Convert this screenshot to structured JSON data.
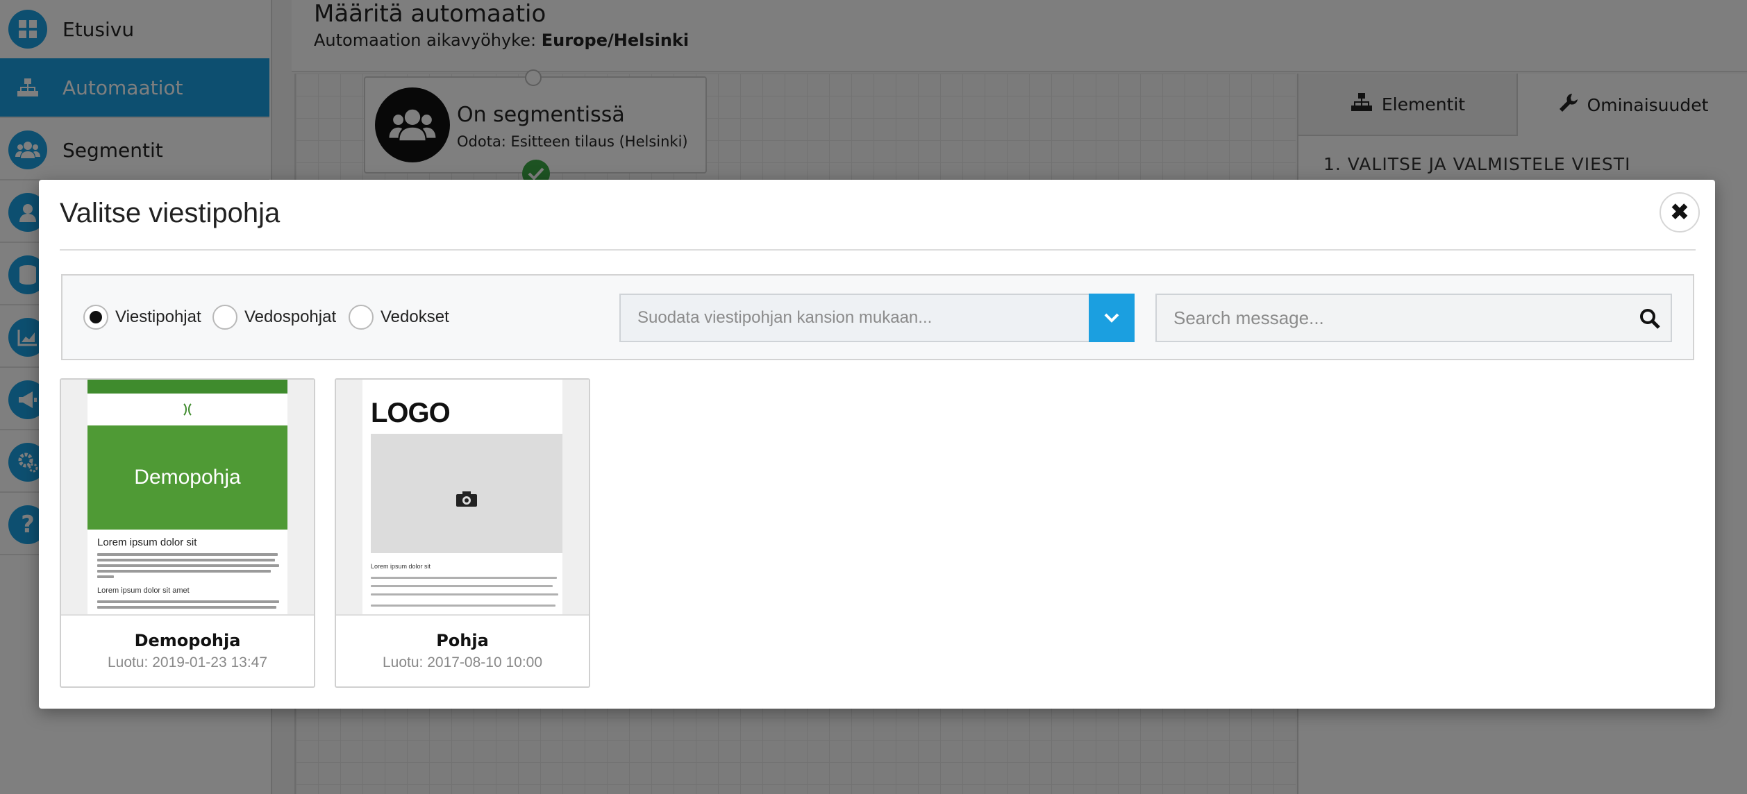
{
  "sidebar": {
    "items": [
      {
        "label": "Etusivu",
        "icon": "dashboard-icon"
      },
      {
        "label": "Automaatiot",
        "icon": "sitemap-icon"
      },
      {
        "label": "Segmentit",
        "icon": "users-icon"
      },
      {
        "label": "",
        "icon": "user-icon"
      },
      {
        "label": "",
        "icon": "database-icon"
      },
      {
        "label": "",
        "icon": "chart-icon"
      },
      {
        "label": "",
        "icon": "megaphone-icon"
      },
      {
        "label": "",
        "icon": "cogs-icon"
      },
      {
        "label": "",
        "icon": "help-icon"
      }
    ],
    "active_index": 1
  },
  "page": {
    "title": "Määritä automaatio",
    "timezone_label": "Automaation aikavyöhyke:",
    "timezone_value": "Europe/Helsinki"
  },
  "canvas": {
    "node": {
      "title": "On segmentissä",
      "subtitle": "Odota: Esitteen tilaus (Helsinki)"
    }
  },
  "right_panel": {
    "tabs": [
      {
        "label": "Elementit",
        "icon": "sitemap-icon"
      },
      {
        "label": "Ominaisuudet",
        "icon": "wrench-icon"
      }
    ],
    "section_title": "1. VALITSE JA VALMISTELE VIESTI"
  },
  "modal": {
    "title": "Valitse viestipohja",
    "close_glyph": "✖",
    "radios": [
      {
        "label": "Viestipohjat",
        "checked": true
      },
      {
        "label": "Vedospohjat",
        "checked": false
      },
      {
        "label": "Vedokset",
        "checked": false
      }
    ],
    "folder_filter_placeholder": "Suodata viestipohjan kansion mukaan...",
    "search_placeholder": "Search message...",
    "templates": [
      {
        "name": "Demopohja",
        "created": "Luotu: 2019-01-23 13:47",
        "preview": {
          "hero_text": "Demopohja",
          "heading": "Lorem ipsum dolor sit",
          "subheading": "Lorem ipsum dolor sit amet"
        }
      },
      {
        "name": "Pohja",
        "created": "Luotu: 2017-08-10 10:00",
        "preview": {
          "logo_text": "LOGO",
          "heading": "Lorem ipsum dolor sit"
        }
      }
    ]
  },
  "colors": {
    "accent": "#1b9fe0",
    "success": "#3aa745",
    "template_green": "#4f9a35"
  }
}
